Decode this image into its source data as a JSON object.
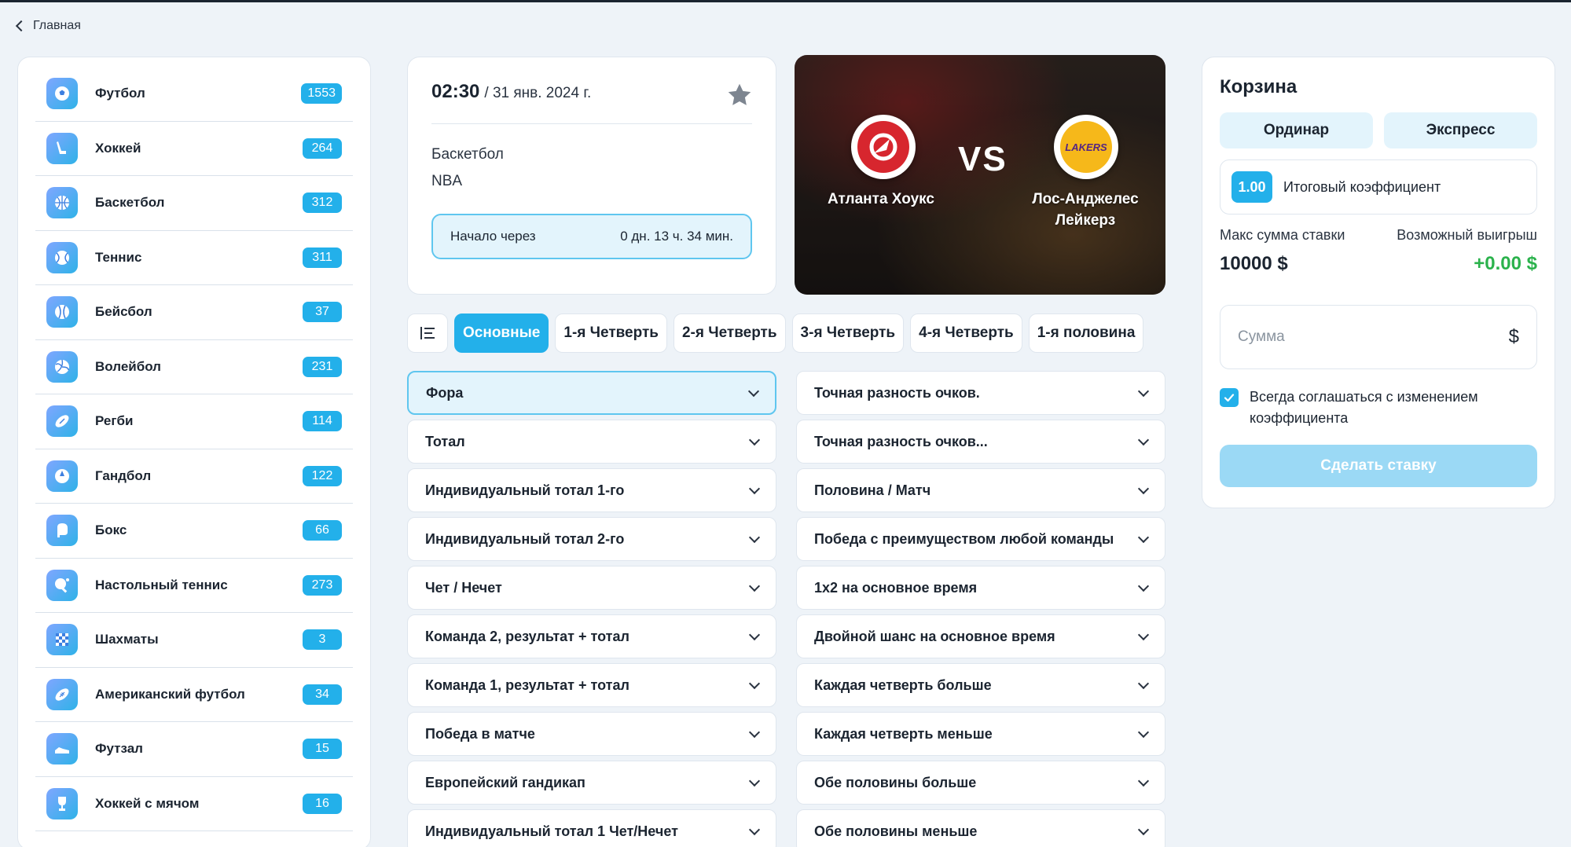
{
  "breadcrumb": {
    "label": "Главная"
  },
  "sidebar": {
    "items": [
      {
        "label": "Футбол",
        "count": "1553",
        "icon": "soccer-ball-icon"
      },
      {
        "label": "Хоккей",
        "count": "264",
        "icon": "hockey-icon"
      },
      {
        "label": "Баскетбол",
        "count": "312",
        "icon": "basketball-icon"
      },
      {
        "label": "Теннис",
        "count": "311",
        "icon": "tennis-ball-icon"
      },
      {
        "label": "Бейсбол",
        "count": "37",
        "icon": "baseball-icon"
      },
      {
        "label": "Волейбол",
        "count": "231",
        "icon": "volleyball-icon"
      },
      {
        "label": "Регби",
        "count": "114",
        "icon": "rugby-ball-icon"
      },
      {
        "label": "Гандбол",
        "count": "122",
        "icon": "handball-icon"
      },
      {
        "label": "Бокс",
        "count": "66",
        "icon": "boxing-glove-icon"
      },
      {
        "label": "Настольный теннис",
        "count": "273",
        "icon": "table-tennis-icon"
      },
      {
        "label": "Шахматы",
        "count": "3",
        "icon": "chess-board-icon"
      },
      {
        "label": "Американский футбол",
        "count": "34",
        "icon": "american-football-icon"
      },
      {
        "label": "Футзал",
        "count": "15",
        "icon": "futsal-shoe-icon"
      },
      {
        "label": "Хоккей с мячом",
        "count": "16",
        "icon": "trophy-icon"
      }
    ]
  },
  "match": {
    "time": "02:30",
    "date": "/ 31 янв. 2024 г.",
    "sport": "Баскетбол",
    "league": "NBA",
    "countdown_label": "Начало через",
    "countdown_value": "0 дн. 13 ч. 34 мин.",
    "home_team": "Атланта Хоукс",
    "away_team_line1": "Лос-Анджелес",
    "away_team_line2": "Лейкерз",
    "vs": "VS",
    "away_logo_text": "LAKERS"
  },
  "tabs": [
    "Основные",
    "1-я Четверть",
    "2-я Четверть",
    "3-я Четверть",
    "4-я Четверть",
    "1-я половина"
  ],
  "markets": {
    "left": [
      "Фора",
      "Тотал",
      "Индивидуальный тотал 1-го",
      "Индивидуальный тотал 2-го",
      "Чет / Нечет",
      "Команда 2, результат + тотал",
      "Команда 1, результат + тотал",
      "Победа в матче",
      "Европейский гандикап",
      "Индивидуальный тотал 1 Чет/Нечет"
    ],
    "right": [
      "Точная разность очков.",
      "Точная разность очков...",
      "Половина / Матч",
      "Победа с преимуществом любой команды",
      "1х2 на основное время",
      "Двойной шанс на основное время",
      "Каждая четверть больше",
      "Каждая четверть меньше",
      "Обе половины больше",
      "Обе половины меньше"
    ]
  },
  "cart": {
    "title": "Корзина",
    "type_single": "Ординар",
    "type_express": "Экспресс",
    "coef_value": "1.00",
    "coef_label": "Итоговый коэффициент",
    "max_label": "Макс сумма ставки",
    "win_label": "Возможный выигрыш",
    "max_value": "10000 $",
    "win_value": "+0.00 $",
    "amount_placeholder": "Сумма",
    "currency": "$",
    "agree_line1": "Всегда соглашаться с изменением",
    "agree_line2": "коэффициента",
    "submit_label": "Сделать ставку"
  },
  "colors": {
    "accent": "#23b0ea",
    "accent_light": "#e3f4fc",
    "win_green": "#2bb24c",
    "background": "#eef3f8"
  }
}
